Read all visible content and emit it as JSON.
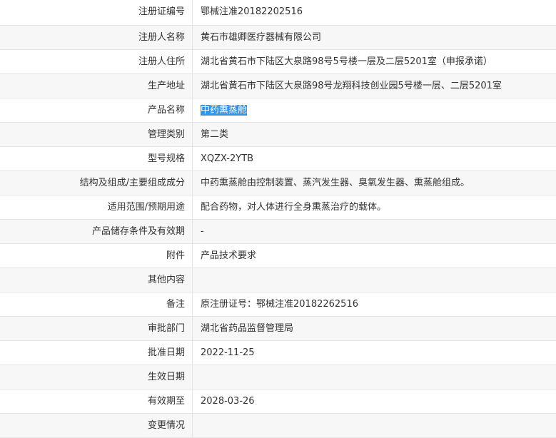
{
  "record": {
    "rows": [
      {
        "label": "注册证编号",
        "value": "鄂械注准20182202516"
      },
      {
        "label": "注册人名称",
        "value": "黄石市雄卿医疗器械有限公司"
      },
      {
        "label": "注册人住所",
        "value": "湖北省黄石市下陆区大泉路98号5号楼一层及二层5201室（申报承诺）"
      },
      {
        "label": "生产地址",
        "value": "湖北省黄石市下陆区大泉路98号龙翔科技创业园5号楼一层、二层5201室"
      },
      {
        "label": "产品名称",
        "value": "中药熏蒸舱"
      },
      {
        "label": "管理类别",
        "value": "第二类"
      },
      {
        "label": "型号规格",
        "value": "XQZX-2YTB"
      },
      {
        "label": "结构及组成/主要组成成分",
        "value": "中药熏蒸舱由控制装置、蒸汽发生器、臭氧发生器、熏蒸舱组成。"
      },
      {
        "label": "适用范围/预期用途",
        "value": "配合药物，对人体进行全身熏蒸治疗的载体。"
      },
      {
        "label": "产品储存条件及有效期",
        "value": "-"
      },
      {
        "label": "附件",
        "value": "产品技术要求"
      },
      {
        "label": "其他内容",
        "value": ""
      },
      {
        "label": "备注",
        "value": "原注册证号：鄂械注准20182262516"
      },
      {
        "label": "审批部门",
        "value": "湖北省药品监督管理局"
      },
      {
        "label": "批准日期",
        "value": "2022-11-25"
      },
      {
        "label": "生效日期",
        "value": ""
      },
      {
        "label": "有效期至",
        "value": "2028-03-26"
      },
      {
        "label": "变更情况",
        "value": ""
      }
    ]
  },
  "colors": {
    "row_alt_bg": "#f7f7f7",
    "border": "#e4e4e4",
    "selection_bg": "#3393e6"
  }
}
